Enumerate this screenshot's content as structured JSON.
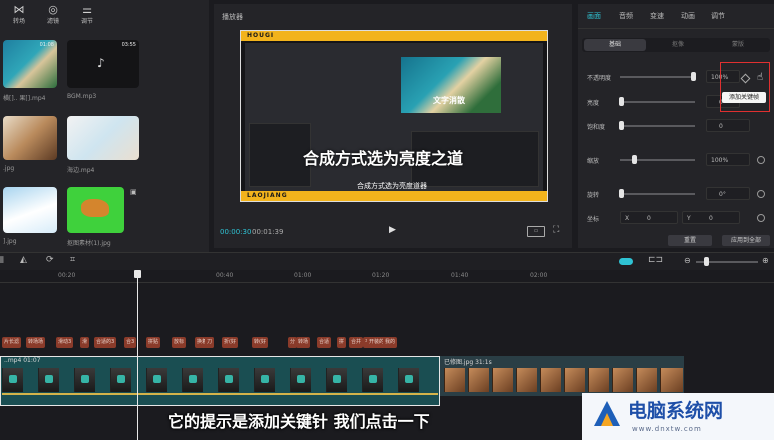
{
  "toolbar": {
    "items": [
      {
        "label": "转场",
        "icon": "transition-icon"
      },
      {
        "label": "滤镜",
        "icon": "filter-icon"
      },
      {
        "label": "调节",
        "icon": "adjust-icon"
      }
    ]
  },
  "media": {
    "items": [
      {
        "label": "横[].. 果[].mp4",
        "duration": "01:08"
      },
      {
        "label": "BGM.mp3",
        "duration": "03:55"
      },
      {
        "label": ".jpg",
        "duration": ""
      },
      {
        "label": "海边.mp4",
        "duration": ""
      },
      {
        "label": "].jpg",
        "duration": ""
      },
      {
        "label": "抠图素材(1).jpg",
        "duration": ""
      }
    ]
  },
  "player": {
    "title": "播放器",
    "current_time": "00:00:30",
    "total_time": "00:01:39",
    "preview": {
      "band_text": "HOUGI",
      "bottom_band_text": "LAOJIANG",
      "main_caption": "合成方式选为亮度之道",
      "sub_caption": "合成方式选为亮度道器",
      "inner_text": "文字消散"
    }
  },
  "inspector": {
    "tabs": [
      "画面",
      "音频",
      "变速",
      "动画",
      "调节"
    ],
    "active_tab": 0,
    "subtabs": [
      "基础",
      "抠像",
      "蒙版"
    ],
    "opacity": {
      "label": "不透明度",
      "value": "100%"
    },
    "brightness": {
      "label": "亮度",
      "value": "0"
    },
    "saturation": {
      "label": "饱和度",
      "value": "0"
    },
    "scale": {
      "label": "缩放",
      "value": "100%"
    },
    "rotate": {
      "label": "旋转",
      "value": "0°"
    },
    "position": {
      "label": "坐标",
      "x_label": "X",
      "x_value": "0",
      "y_label": "Y",
      "y_value": "0"
    },
    "tooltip": "添加关键帧",
    "reset_button": "重置",
    "apply_all_button": "应用到全部"
  },
  "timeline": {
    "ruler": [
      "00:20",
      "00:40",
      "01:00",
      "01:20",
      "01:40",
      "02:00"
    ],
    "text_chips": [
      "片长滤",
      "转场场",
      "滑动3",
      "滑",
      "合适的3",
      "合3",
      "拼贴",
      "放标",
      "换着了",
      "刀",
      "折(好",
      "转(好",
      "分",
      "转场",
      "合适",
      "拼",
      "合并",
      "平",
      "开装的",
      "我的"
    ],
    "clip1_label": "..mp4   01:07",
    "clip2_label": "已修图.jpg   31:1s"
  },
  "subtitle": "它的提示是添加关键针 我们点击一下",
  "watermark": {
    "title": "电脑系统网",
    "url": "www.dnxtw.com"
  },
  "colors": {
    "accent": "#2fc3d4",
    "highlight_red": "#e03030",
    "band_yellow": "#f2b31c"
  }
}
